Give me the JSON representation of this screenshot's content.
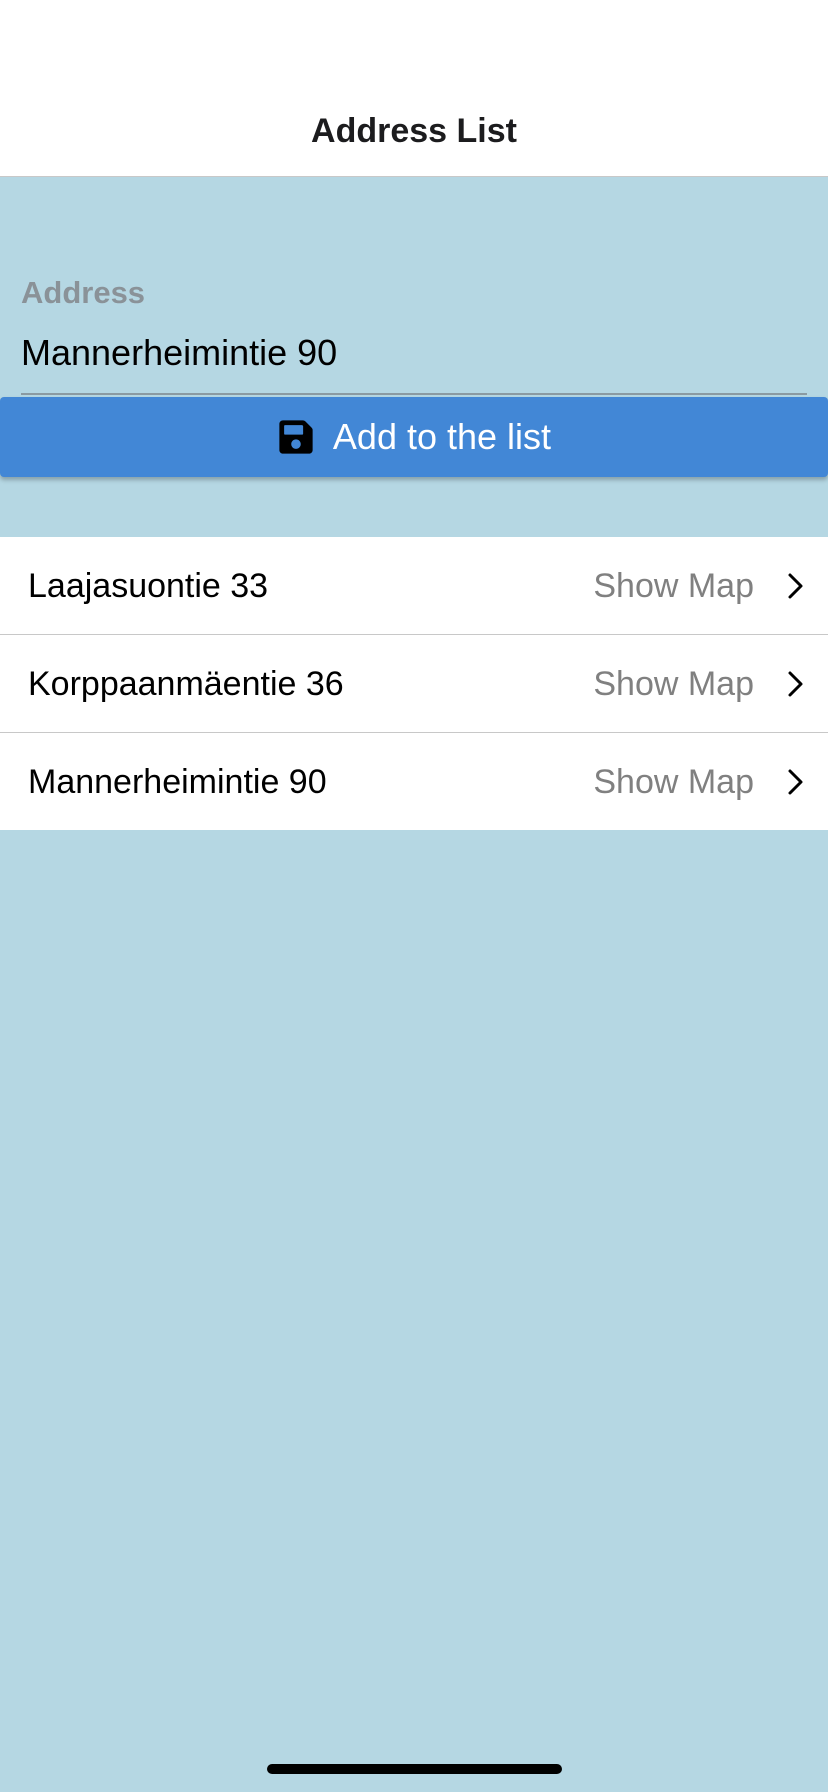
{
  "header": {
    "title": "Address List"
  },
  "form": {
    "address_label": "Address",
    "address_value": "Mannerheimintie 90",
    "add_button_label": "Add to the list",
    "add_button_icon": "save-icon"
  },
  "list": {
    "items": [
      {
        "address": "Laajasuontie 33",
        "action": "Show Map"
      },
      {
        "address": "Korppaanmäentie 36",
        "action": "Show Map"
      },
      {
        "address": "Mannerheimintie 90",
        "action": "Show Map"
      }
    ]
  },
  "colors": {
    "background": "#b5d7e3",
    "button": "#4287d6",
    "header": "#ffffff"
  }
}
